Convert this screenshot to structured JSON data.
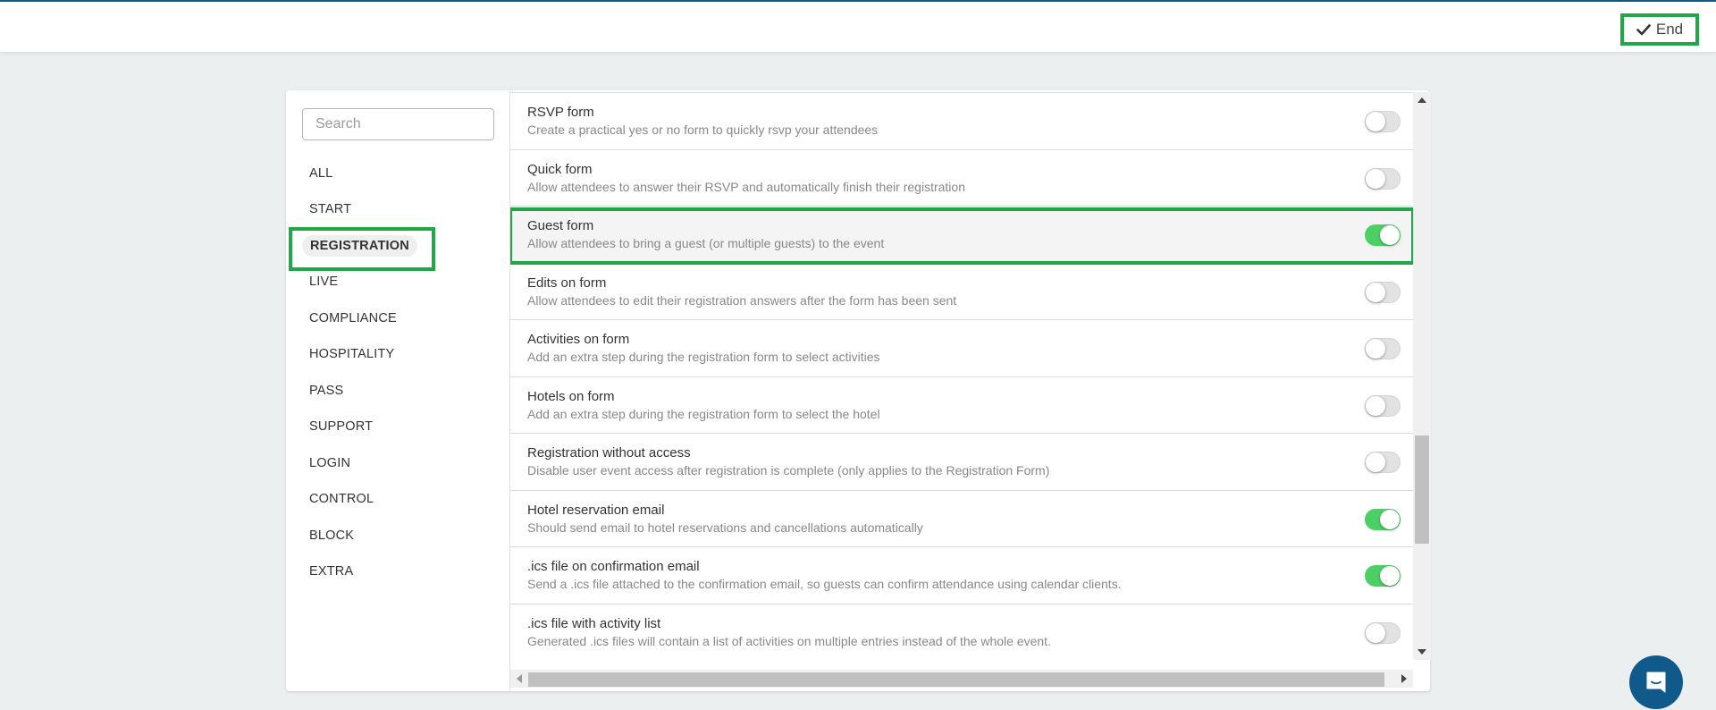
{
  "header": {
    "end_button": {
      "label": "End",
      "icon": "check-icon"
    }
  },
  "colors": {
    "brand": "#0f5a8a",
    "highlight_outline": "#20a847",
    "toggle_on": "#4cd066",
    "toggle_off": "#e2e2e2"
  },
  "sidebar": {
    "search_placeholder": "Search",
    "search_value": "",
    "items": [
      {
        "label": "ALL",
        "active": false
      },
      {
        "label": "START",
        "active": false
      },
      {
        "label": "REGISTRATION",
        "active": true
      },
      {
        "label": "LIVE",
        "active": false
      },
      {
        "label": "COMPLIANCE",
        "active": false
      },
      {
        "label": "HOSPITALITY",
        "active": false
      },
      {
        "label": "PASS",
        "active": false
      },
      {
        "label": "SUPPORT",
        "active": false
      },
      {
        "label": "LOGIN",
        "active": false
      },
      {
        "label": "CONTROL",
        "active": false
      },
      {
        "label": "BLOCK",
        "active": false
      },
      {
        "label": "EXTRA",
        "active": false
      }
    ]
  },
  "features": [
    {
      "title": "RSVP form",
      "description": "Create a practical yes or no form to quickly rsvp your attendees",
      "enabled": false
    },
    {
      "title": "Quick form",
      "description": "Allow attendees to answer their RSVP and automatically finish their registration",
      "enabled": false
    },
    {
      "title": "Guest form",
      "description": "Allow attendees to bring a guest (or multiple guests) to the event",
      "enabled": true,
      "highlighted": true
    },
    {
      "title": "Edits on form",
      "description": "Allow attendees to edit their registration answers after the form has been sent",
      "enabled": false
    },
    {
      "title": "Activities on form",
      "description": "Add an extra step during the registration form to select activities",
      "enabled": false
    },
    {
      "title": "Hotels on form",
      "description": "Add an extra step during the registration form to select the hotel",
      "enabled": false
    },
    {
      "title": "Registration without access",
      "description": "Disable user event access after registration is complete (only applies to the Registration Form)",
      "enabled": false
    },
    {
      "title": "Hotel reservation email",
      "description": "Should send email to hotel reservations and cancellations automatically",
      "enabled": true
    },
    {
      "title": ".ics file on confirmation email",
      "description": "Send a .ics file attached to the confirmation email, so guests can confirm attendance using calendar clients.",
      "enabled": true
    },
    {
      "title": ".ics file with activity list",
      "description": "Generated .ics files will contain a list of activities on multiple entries instead of the whole event.",
      "enabled": false
    }
  ],
  "chat": {
    "icon": "chat-icon"
  }
}
